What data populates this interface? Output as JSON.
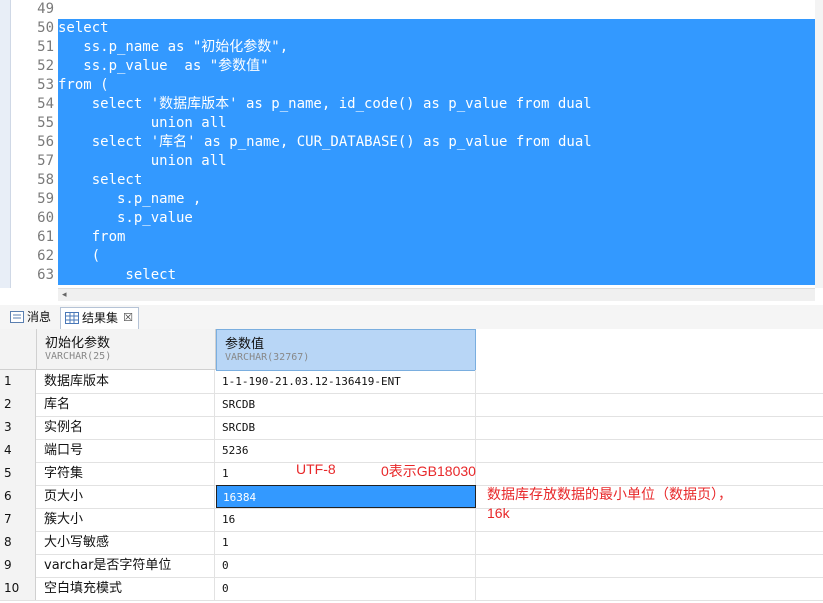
{
  "editor": {
    "lines": [
      {
        "no": "49",
        "text": "",
        "selected": false
      },
      {
        "no": "50",
        "text": "select",
        "selected": true
      },
      {
        "no": "51",
        "text": "   ss.p_name as \"初始化参数\",",
        "selected": true
      },
      {
        "no": "52",
        "text": "   ss.p_value  as \"参数值\"",
        "selected": true
      },
      {
        "no": "53",
        "text": "from (",
        "selected": true
      },
      {
        "no": "54",
        "text": "    select '数据库版本' as p_name, id_code() as p_value from dual",
        "selected": true
      },
      {
        "no": "55",
        "text": "           union all",
        "selected": true
      },
      {
        "no": "56",
        "text": "    select '库名' as p_name, CUR_DATABASE() as p_value from dual",
        "selected": true
      },
      {
        "no": "57",
        "text": "           union all",
        "selected": true
      },
      {
        "no": "58",
        "text": "    select",
        "selected": true
      },
      {
        "no": "59",
        "text": "       s.p_name ,",
        "selected": true
      },
      {
        "no": "60",
        "text": "       s.p_value",
        "selected": true
      },
      {
        "no": "61",
        "text": "    from",
        "selected": true
      },
      {
        "no": "62",
        "text": "    (",
        "selected": true
      },
      {
        "no": "63",
        "text": "        select",
        "selected": true
      }
    ]
  },
  "tabs": {
    "messages": "消息",
    "results": "结果集",
    "close": "☒"
  },
  "grid": {
    "columns": [
      {
        "name": "初始化参数",
        "type": "VARCHAR(25)"
      },
      {
        "name": "参数值",
        "type": "VARCHAR(32767)"
      }
    ],
    "rows": [
      {
        "n": "1",
        "param": "数据库版本",
        "value": "1-1-190-21.03.12-136419-ENT"
      },
      {
        "n": "2",
        "param": "库名",
        "value": "SRCDB"
      },
      {
        "n": "3",
        "param": "实例名",
        "value": "SRCDB"
      },
      {
        "n": "4",
        "param": "端口号",
        "value": "5236"
      },
      {
        "n": "5",
        "param": "字符集",
        "value": "1"
      },
      {
        "n": "6",
        "param": "页大小",
        "value": "16384"
      },
      {
        "n": "7",
        "param": "簇大小",
        "value": "16"
      },
      {
        "n": "8",
        "param": "大小写敏感",
        "value": "1"
      },
      {
        "n": "9",
        "param": "varchar是否字符单位",
        "value": "0"
      },
      {
        "n": "10",
        "param": "空白填充模式",
        "value": "0"
      }
    ],
    "selected_row": 6
  },
  "annotations": {
    "utf8": "UTF-8",
    "gb": "0表示GB18030",
    "page_note_1": "数据库存放数据的最小单位（数据页），",
    "page_note_2": "16k"
  }
}
